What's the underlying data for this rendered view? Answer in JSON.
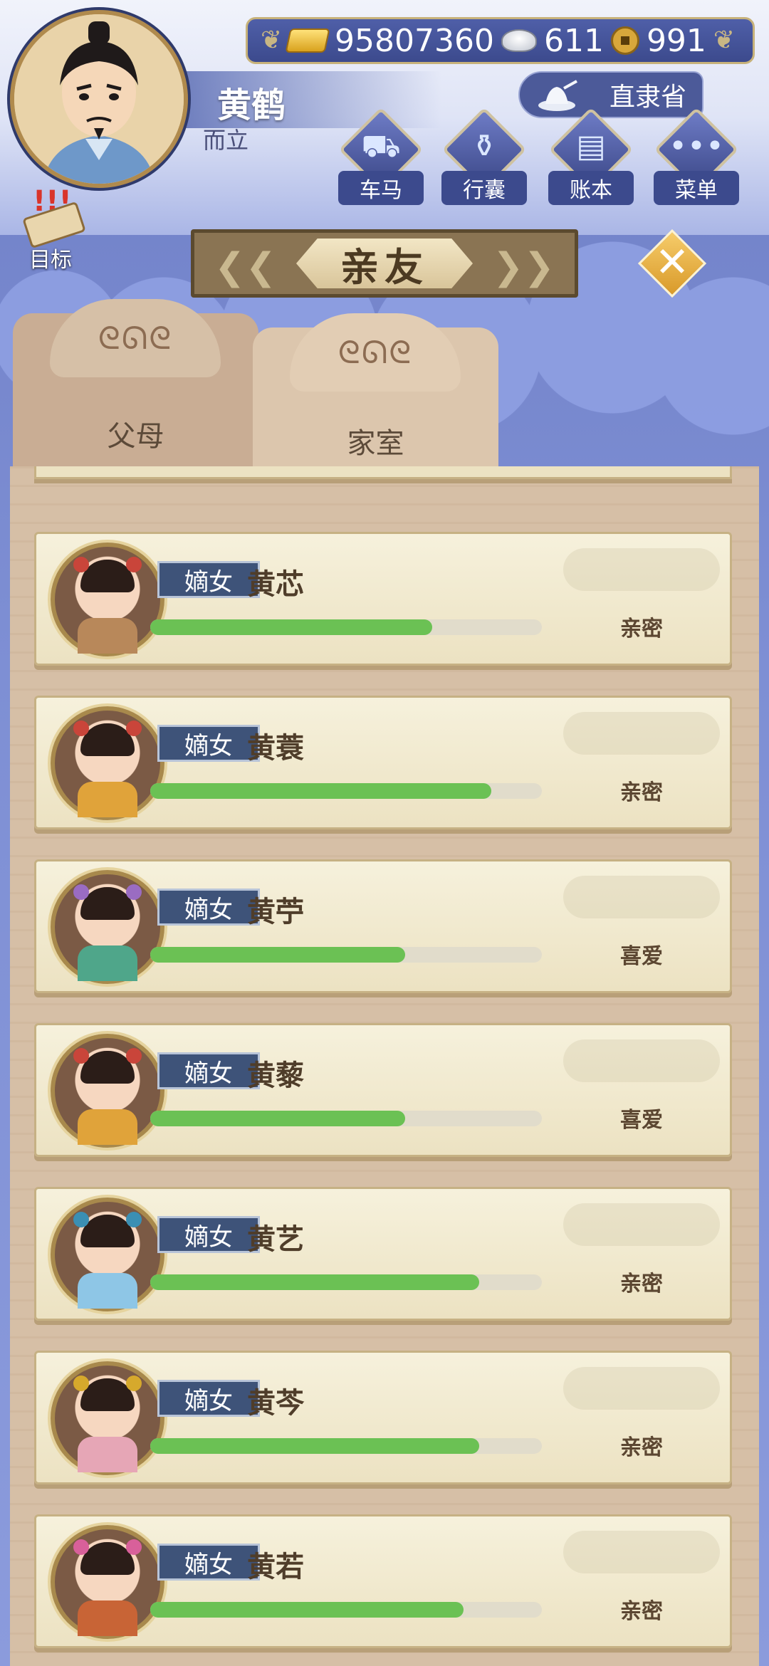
{
  "player": {
    "name": "黄鹤",
    "rank": "而立"
  },
  "currency": {
    "gold": "95807360",
    "silver": "611",
    "coin": "991"
  },
  "region": {
    "label": "直隶省"
  },
  "menu": [
    {
      "label": "车马",
      "icon": "carriage-icon"
    },
    {
      "label": "行囊",
      "icon": "bag-icon"
    },
    {
      "label": "账本",
      "icon": "ledger-icon"
    },
    {
      "label": "菜单",
      "icon": "more-icon"
    }
  ],
  "goal": {
    "label": "目标",
    "alert": "!!!"
  },
  "title": "亲友",
  "tabs": [
    {
      "label": "父母"
    },
    {
      "label": "家室"
    }
  ],
  "members": [
    {
      "role": "嫡女",
      "name": "黄芯",
      "status": "亲密",
      "progress": 0.72,
      "robe": "#b8885a",
      "flower": "#c9453a"
    },
    {
      "role": "嫡女",
      "name": "黄蓑",
      "status": "亲密",
      "progress": 0.87,
      "robe": "#e0a33a",
      "flower": "#c9453a"
    },
    {
      "role": "嫡女",
      "name": "黄苧",
      "status": "喜爱",
      "progress": 0.65,
      "robe": "#4fa68a",
      "flower": "#9a6cc2"
    },
    {
      "role": "嫡女",
      "name": "黄藜",
      "status": "喜爱",
      "progress": 0.65,
      "robe": "#e0a33a",
      "flower": "#c9453a"
    },
    {
      "role": "嫡女",
      "name": "黄艺",
      "status": "亲密",
      "progress": 0.84,
      "robe": "#8ec6e6",
      "flower": "#3b8fb3"
    },
    {
      "role": "嫡女",
      "name": "黄芩",
      "status": "亲密",
      "progress": 0.84,
      "robe": "#e6a6b6",
      "flower": "#d6a92c"
    },
    {
      "role": "嫡女",
      "name": "黄若",
      "status": "亲密",
      "progress": 0.8,
      "robe": "#c86436",
      "flower": "#d8609a"
    }
  ]
}
